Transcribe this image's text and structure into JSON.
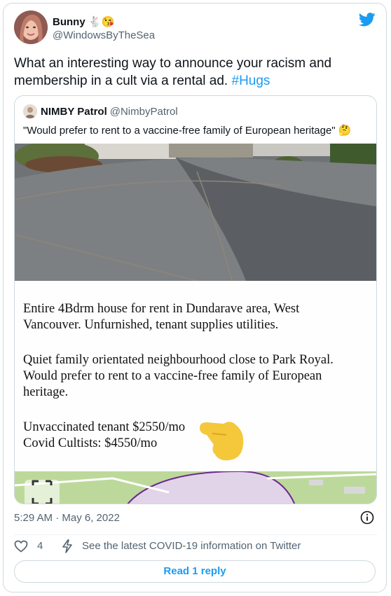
{
  "tweet": {
    "author_name": "Bunny 🐇😘",
    "author_handle": "@WindowsByTheSea",
    "text_main": "What an interesting way to announce your racism and membership in a cult via a rental ad. ",
    "hashtag": "#Hugs",
    "timestamp": "5:29 AM · May 6, 2022",
    "likes": "4",
    "covid_link": "See the latest COVID-19 information on Twitter",
    "reply_button": "Read 1 reply"
  },
  "quoted": {
    "author_name": "NIMBY Patrol",
    "author_handle": "@NimbyPatrol",
    "text": "\"Would prefer to rent to a vaccine-free family of European heritage\" 🤔",
    "ad_lines": {
      "line1": "Entire 4Bdrm house for rent in Dundarave area, West",
      "line2": "Vancouver. Unfurnished, tenant supplies utilities.",
      "line3": "Quiet family orientated neighbourhood close to Park Royal.",
      "line4": "Would prefer to rent to a vaccine-free family of European",
      "line5": "heritage.",
      "line6": "Unvaccinated tenant $2550/mo",
      "line7": "Covid Cultists: $4550/mo"
    }
  },
  "icons": {
    "logo": "twitter-bird-icon",
    "info": "info-icon",
    "like": "heart-icon",
    "covid": "lightning-icon",
    "expand": "expand-icon",
    "pointing": "pointing-hand-emoji"
  },
  "colors": {
    "accent": "#1d9bf0",
    "secondary_text": "#536471",
    "border": "#cfd9de"
  }
}
